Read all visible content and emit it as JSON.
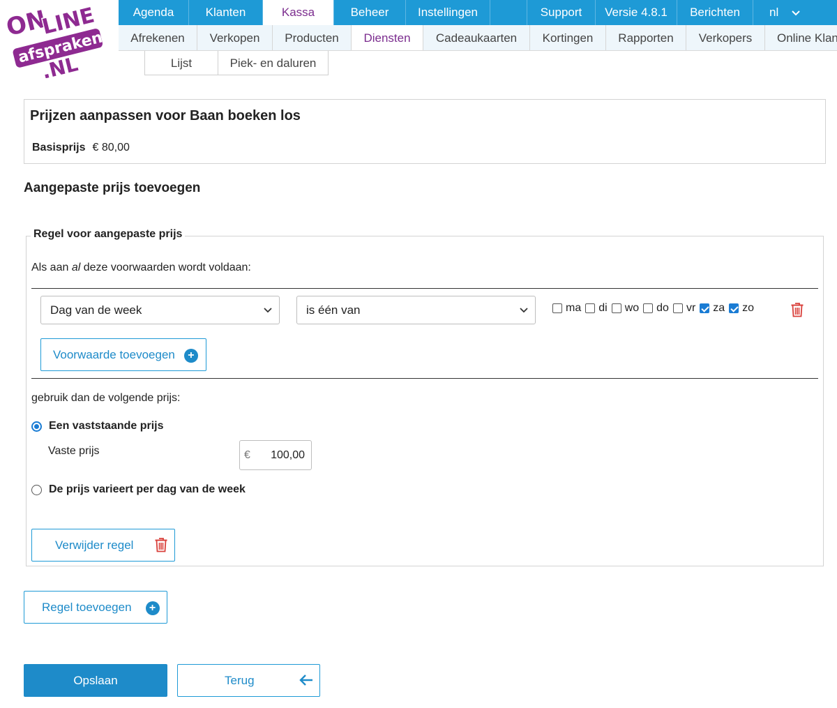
{
  "logo": {
    "line1": "ON",
    "line2": "LINE",
    "line3": "afspraken",
    "line4": ".NL"
  },
  "topnav": [
    {
      "label": "Agenda"
    },
    {
      "label": "Klanten"
    },
    {
      "label": "Kassa"
    },
    {
      "label": "Beheer"
    },
    {
      "label": "Instellingen"
    },
    {
      "label": "Support"
    },
    {
      "label": "Versie 4.8.1"
    },
    {
      "label": "Berichten"
    },
    {
      "label": "nl"
    }
  ],
  "subnav": [
    {
      "label": "Afrekenen"
    },
    {
      "label": "Verkopen"
    },
    {
      "label": "Producten"
    },
    {
      "label": "Diensten"
    },
    {
      "label": "Cadeaukaarten"
    },
    {
      "label": "Kortingen"
    },
    {
      "label": "Rapporten"
    },
    {
      "label": "Verkopers"
    },
    {
      "label": "Online Klan"
    }
  ],
  "thirdnav": [
    {
      "label": "Lijst"
    },
    {
      "label": "Piek- en daluren"
    }
  ],
  "header": {
    "title": "Prijzen aanpassen voor Baan boeken los",
    "base_label": "Basisprijs",
    "base_value": "€ 80,00"
  },
  "section_title": "Aangepaste prijs toevoegen",
  "rule": {
    "legend": "Regel voor aangepaste prijs",
    "condition_pre": "Als aan ",
    "condition_em": "al",
    "condition_post": " deze voorwaarden wordt voldaan:",
    "field_select": "Dag van de week",
    "operator_select": "is één van",
    "days": [
      {
        "label": "ma",
        "checked": false
      },
      {
        "label": "di",
        "checked": false
      },
      {
        "label": "wo",
        "checked": false
      },
      {
        "label": "do",
        "checked": false
      },
      {
        "label": "vr",
        "checked": false
      },
      {
        "label": "za",
        "checked": true
      },
      {
        "label": "zo",
        "checked": true
      }
    ],
    "add_condition": "Voorwaarde toevoegen",
    "use_price_text": "gebruik dan de volgende prijs:",
    "option_fixed": "Een vaststaande prijs",
    "fixed_label": "Vaste prijs",
    "currency": "€",
    "fixed_value": "100,00",
    "option_varies": "De prijs varieert per dag van de week",
    "remove_rule": "Verwijder regel"
  },
  "add_rule": "Regel toevoegen",
  "save": "Opslaan",
  "back": "Terug",
  "colors": {
    "accent": "#1e9ad6",
    "active_tab_text": "#7b2c8e",
    "danger": "#d9403b"
  }
}
